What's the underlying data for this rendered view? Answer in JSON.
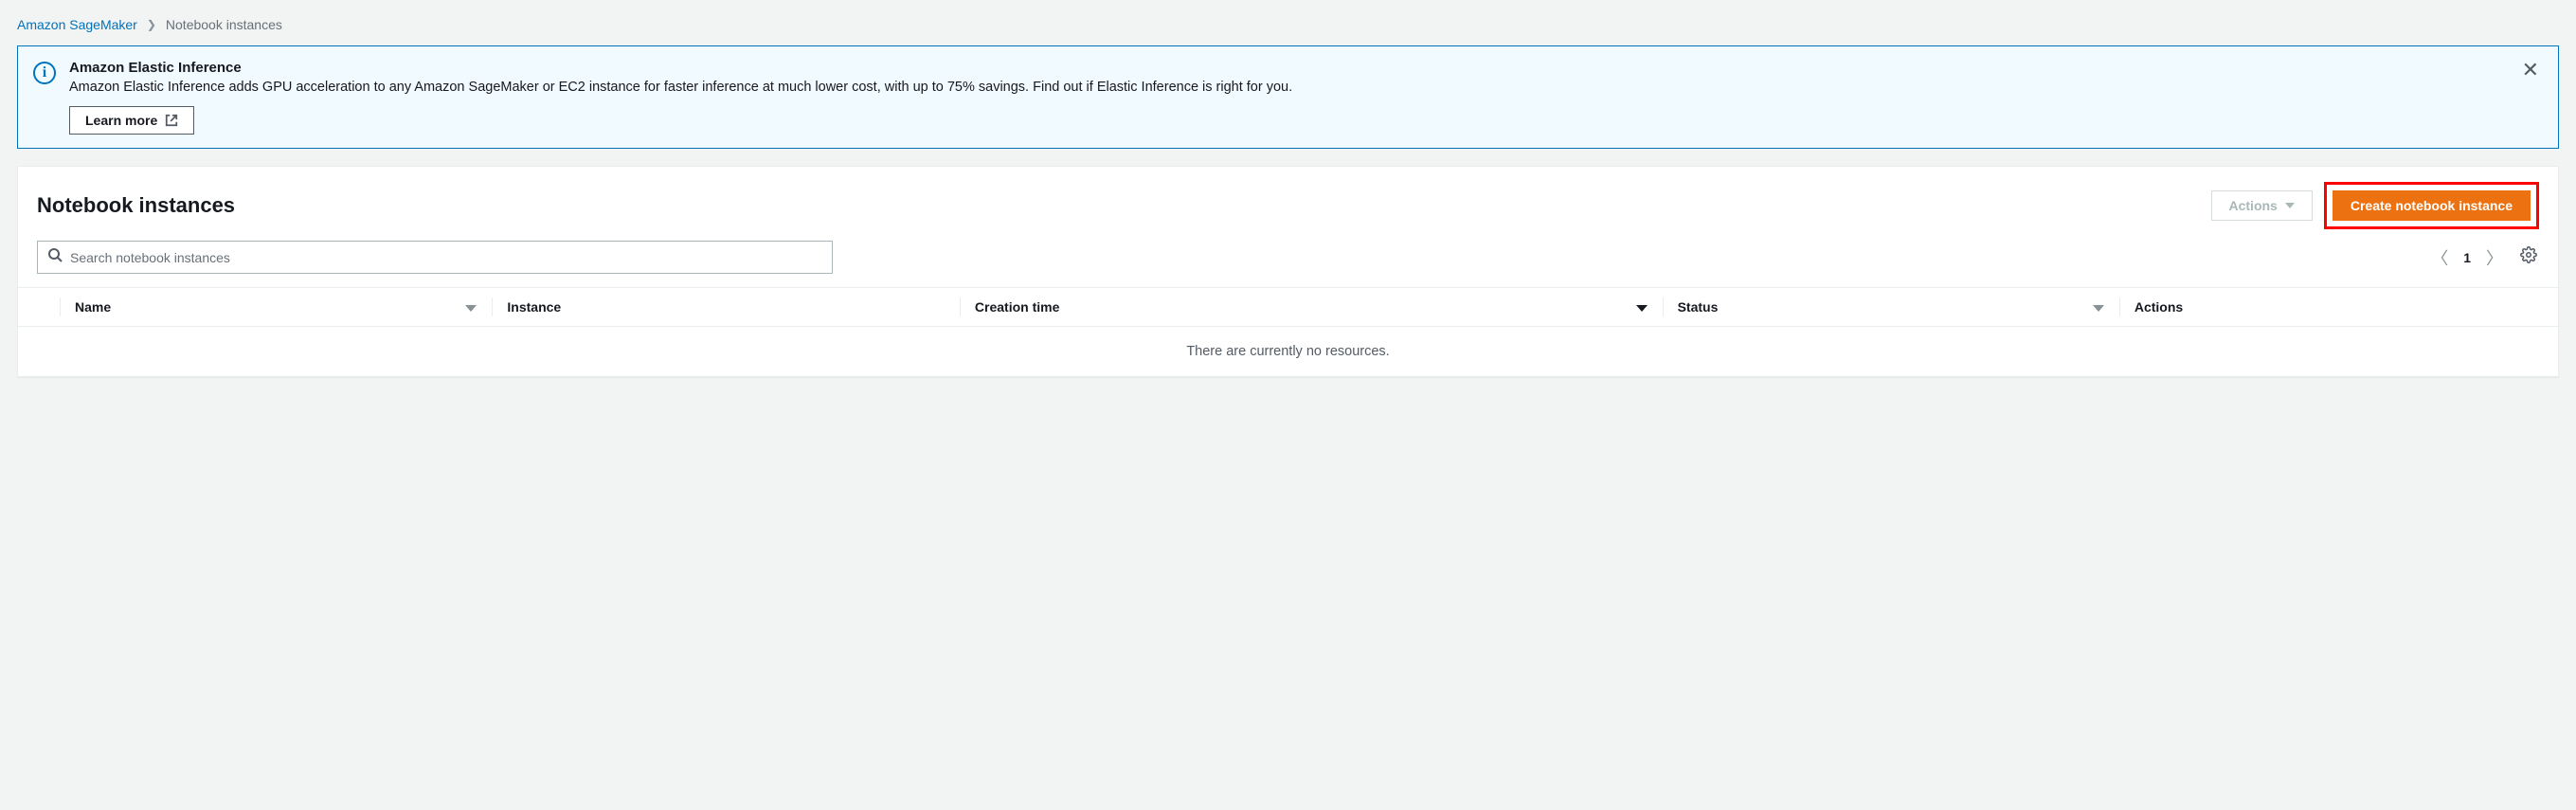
{
  "breadcrumb": {
    "root": "Amazon SageMaker",
    "current": "Notebook instances"
  },
  "banner": {
    "title": "Amazon Elastic Inference",
    "text": "Amazon Elastic Inference adds GPU acceleration to any Amazon SageMaker or EC2 instance for faster inference at much lower cost, with up to 75% savings. Find out if Elastic Inference is right for you.",
    "learn_more": "Learn more"
  },
  "panel": {
    "title": "Notebook instances",
    "actions_label": "Actions",
    "create_label": "Create notebook instance",
    "search_placeholder": "Search notebook instances",
    "page": "1"
  },
  "table": {
    "columns": {
      "name": "Name",
      "instance": "Instance",
      "creation_time": "Creation time",
      "status": "Status",
      "actions": "Actions"
    },
    "empty": "There are currently no resources."
  }
}
